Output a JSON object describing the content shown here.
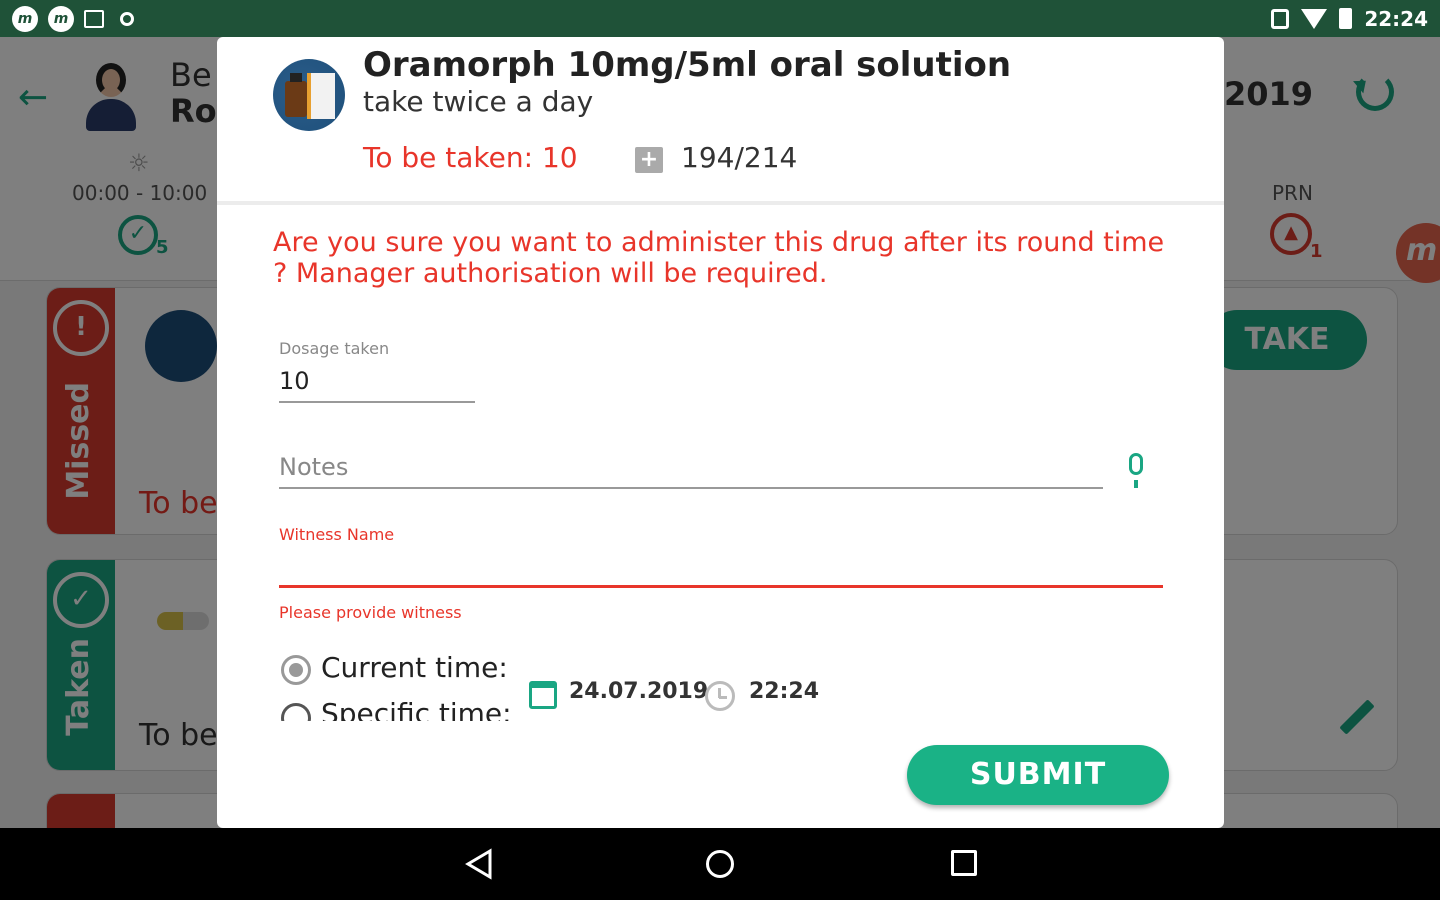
{
  "status_bar": {
    "notif_icon_1": "m",
    "notif_icon_2": "m",
    "time": "22:24"
  },
  "background": {
    "patient_name_line1": "Be",
    "patient_name_line2": "Ro",
    "header_date": "2019",
    "round_time": "00:00 - 10:00",
    "round_taken_count": "5",
    "prn_label": "PRN",
    "prn_count": "1",
    "card1_status": "Missed",
    "card1_to_be": "To be",
    "card1_take": "TAKE",
    "card2_status": "Taken",
    "card2_to_be": "To be"
  },
  "dialog": {
    "drug_name": "Oramorph 10mg/5ml oral solution",
    "dose_instruction": "take twice a day",
    "to_be_taken": "To be taken: 10",
    "stock_count": "194/214",
    "warning": "Are you sure you want to administer this drug after its round time ? Manager authorisation will be required.",
    "dosage_label": "Dosage taken",
    "dosage_value": "10",
    "notes_placeholder": "Notes",
    "witness_label": "Witness Name",
    "witness_value": "",
    "witness_error": "Please provide witness",
    "current_time_label": "Current time:",
    "specific_time_label": "Specific time:",
    "date_value": "24.07.2019",
    "time_value": "22:24",
    "submit_label": "SUBMIT"
  },
  "colors": {
    "accent_green": "#1aa683",
    "error_red": "#e8352a",
    "status_bar": "#1f5238"
  }
}
